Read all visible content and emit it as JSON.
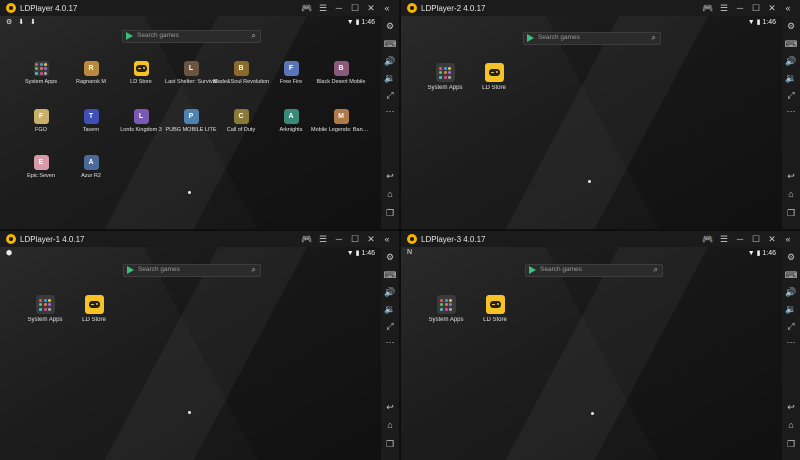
{
  "windows": [
    {
      "title": "LDPlayer 4.0.17",
      "status_left": "⚙ ⬇ ⬇",
      "status_right": "▼ ▮ 1:46",
      "search_placeholder": "Search games",
      "apps": [
        {
          "label": "System Apps",
          "icon": "system-apps-icon"
        },
        {
          "label": "Ragnarok M",
          "icon": "game-icon",
          "color": "#b78a3e"
        },
        {
          "label": "LD Store",
          "icon": "ld-store-icon"
        },
        {
          "label": "Last Shelter: Survival",
          "icon": "game-icon",
          "color": "#6b5440"
        },
        {
          "label": "Blade&Soul Revolution",
          "icon": "game-icon",
          "color": "#8b6a2c"
        },
        {
          "label": "Free Fire",
          "icon": "game-icon",
          "color": "#5a76b8"
        },
        {
          "label": "Black Desert Mobile",
          "icon": "game-icon",
          "color": "#8a5a7a"
        },
        {
          "label": "FGO",
          "icon": "game-icon",
          "color": "#c8b06a"
        },
        {
          "label": "Tavern",
          "icon": "game-icon",
          "color": "#3f4fb8"
        },
        {
          "label": "Lords Kingdom 3",
          "icon": "game-icon",
          "color": "#7a5ab0"
        },
        {
          "label": "PUBG MOBILE LITE",
          "icon": "game-icon",
          "color": "#4f82b0"
        },
        {
          "label": "Call of Duty",
          "icon": "game-icon",
          "color": "#8a7a3a"
        },
        {
          "label": "Arknights",
          "icon": "game-icon",
          "color": "#3a8a7a"
        },
        {
          "label": "Mobile Legends: Bang Bang",
          "icon": "game-icon",
          "color": "#b07a4a"
        },
        {
          "label": "Epic Seven",
          "icon": "game-icon",
          "color": "#d89aa8"
        },
        {
          "label": "Azur R2",
          "icon": "game-icon",
          "color": "#4a6a9a"
        }
      ]
    },
    {
      "title": "LDPlayer-2 4.0.17",
      "status_left": "",
      "status_right": "▼ ▮ 1:46",
      "search_placeholder": "Search games",
      "apps": [
        {
          "label": "System Apps",
          "icon": "system-apps-icon"
        },
        {
          "label": "LD Store",
          "icon": "ld-store-icon"
        }
      ]
    },
    {
      "title": "LDPlayer-1 4.0.17",
      "status_left": "⬢",
      "status_right": "▼ ▮ 1:46",
      "search_placeholder": "Search games",
      "apps": [
        {
          "label": "System Apps",
          "icon": "system-apps-icon"
        },
        {
          "label": "LD Store",
          "icon": "ld-store-icon"
        }
      ]
    },
    {
      "title": "LDPlayer-3 4.0.17",
      "status_left": "N",
      "status_right": "▼ ▮ 1:46",
      "search_placeholder": "Search games",
      "apps": [
        {
          "label": "System Apps",
          "icon": "system-apps-icon"
        },
        {
          "label": "LD Store",
          "icon": "ld-store-icon"
        }
      ]
    }
  ],
  "title_controls": [
    {
      "glyph": "🎮",
      "icon": "gamepad-icon"
    },
    {
      "glyph": "☰",
      "icon": "menu-icon"
    },
    {
      "glyph": "─",
      "icon": "minimize-icon"
    },
    {
      "glyph": "☐",
      "icon": "maximize-icon"
    },
    {
      "glyph": "✕",
      "icon": "close-icon"
    },
    {
      "glyph": "«",
      "icon": "collapse-sidebar-icon"
    }
  ],
  "sidebar_top": [
    {
      "glyph": "⚙",
      "icon": "settings-icon"
    },
    {
      "glyph": "⌨",
      "icon": "keyboard-icon"
    },
    {
      "glyph": "🔊",
      "icon": "volume-up-icon"
    },
    {
      "glyph": "🔉",
      "icon": "volume-down-icon"
    },
    {
      "glyph": "⤢",
      "icon": "fullscreen-icon"
    },
    {
      "glyph": "⋯",
      "icon": "more-icon"
    }
  ],
  "sidebar_bottom": [
    {
      "glyph": "↩",
      "icon": "back-icon"
    },
    {
      "glyph": "⌂",
      "icon": "home-icon"
    },
    {
      "glyph": "❐",
      "icon": "recent-apps-icon"
    }
  ],
  "colors": {
    "accent": "#f7b500",
    "ld_store": "#f7c324",
    "play": "#39c07a"
  }
}
